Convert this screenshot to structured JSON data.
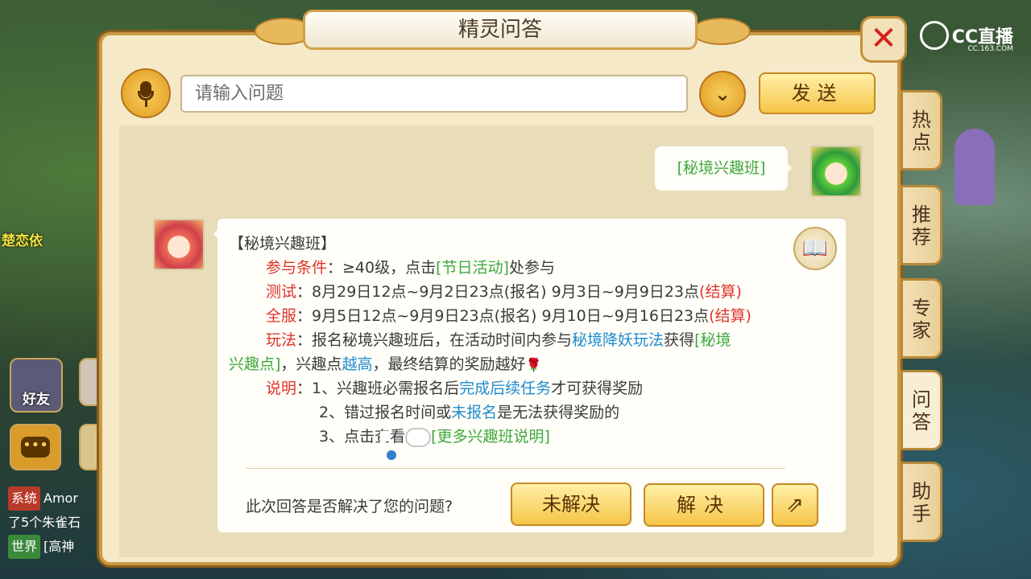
{
  "watermark": {
    "brand": "CC直播",
    "domain": "CC.163.COM"
  },
  "hud": {
    "friends_label": "好友",
    "chat_lines": [
      {
        "tag": "系统",
        "text": "Amor"
      },
      {
        "tag": "",
        "text": "了5个朱雀石"
      },
      {
        "tag": "世界",
        "text": "[高神"
      }
    ]
  },
  "npc": {
    "name": "楚恋依"
  },
  "dialog": {
    "title": "精灵问答",
    "close_symbol": "✕",
    "input_placeholder": "请输入问题",
    "send_label": "发送",
    "dropdown_symbol": "⌄"
  },
  "user_message": "[秘境兴趣班]",
  "answer": {
    "heading": "【秘境兴趣班】",
    "cond_label": "参与条件",
    "cond_a": "：≥40级，点击",
    "cond_link": "[节日活动]",
    "cond_b": "处参与",
    "test_label": "测试",
    "test_text": "：8月29日12点~9月2日23点(报名) 9月3日~9月9日23点",
    "test_settle": "(结算)",
    "full_label": "全服",
    "full_text": "：9月5日12点~9月9日23点(报名) 9月10日~9月16日23点",
    "full_settle": "(结算)",
    "play_label": "玩法",
    "play_a": "：报名秘境兴趣班后，在活动时间内参与",
    "play_link": "秘境降妖玩法",
    "play_b": "获得",
    "play_point1": "[秘境",
    "play_point2": "兴趣点]",
    "play_c": "，兴趣点",
    "play_high": "越高",
    "play_d": "，最终结算的奖励越好",
    "note_label": "说明",
    "note1_a": "：1、兴趣班必需报名后",
    "note1_link": "完成后续任务",
    "note1_b": "才可获得奖励",
    "note2_a": "2、错过报名时间或",
    "note2_link": "未报名",
    "note2_b": "是无法获得奖励的",
    "note3_a": "3、点击查看",
    "note3_link": "[更多兴趣班说明]"
  },
  "feedback": {
    "question": "此次回答是否解决了您的问题?",
    "unsolved": "未解决",
    "solved": "解决",
    "share_symbol": "⇗"
  },
  "side_tabs": [
    {
      "label": "热点",
      "active": false
    },
    {
      "label": "推荐",
      "active": false
    },
    {
      "label": "专家",
      "active": false
    },
    {
      "label": "问答",
      "active": true
    },
    {
      "label": "助手",
      "active": false
    }
  ]
}
